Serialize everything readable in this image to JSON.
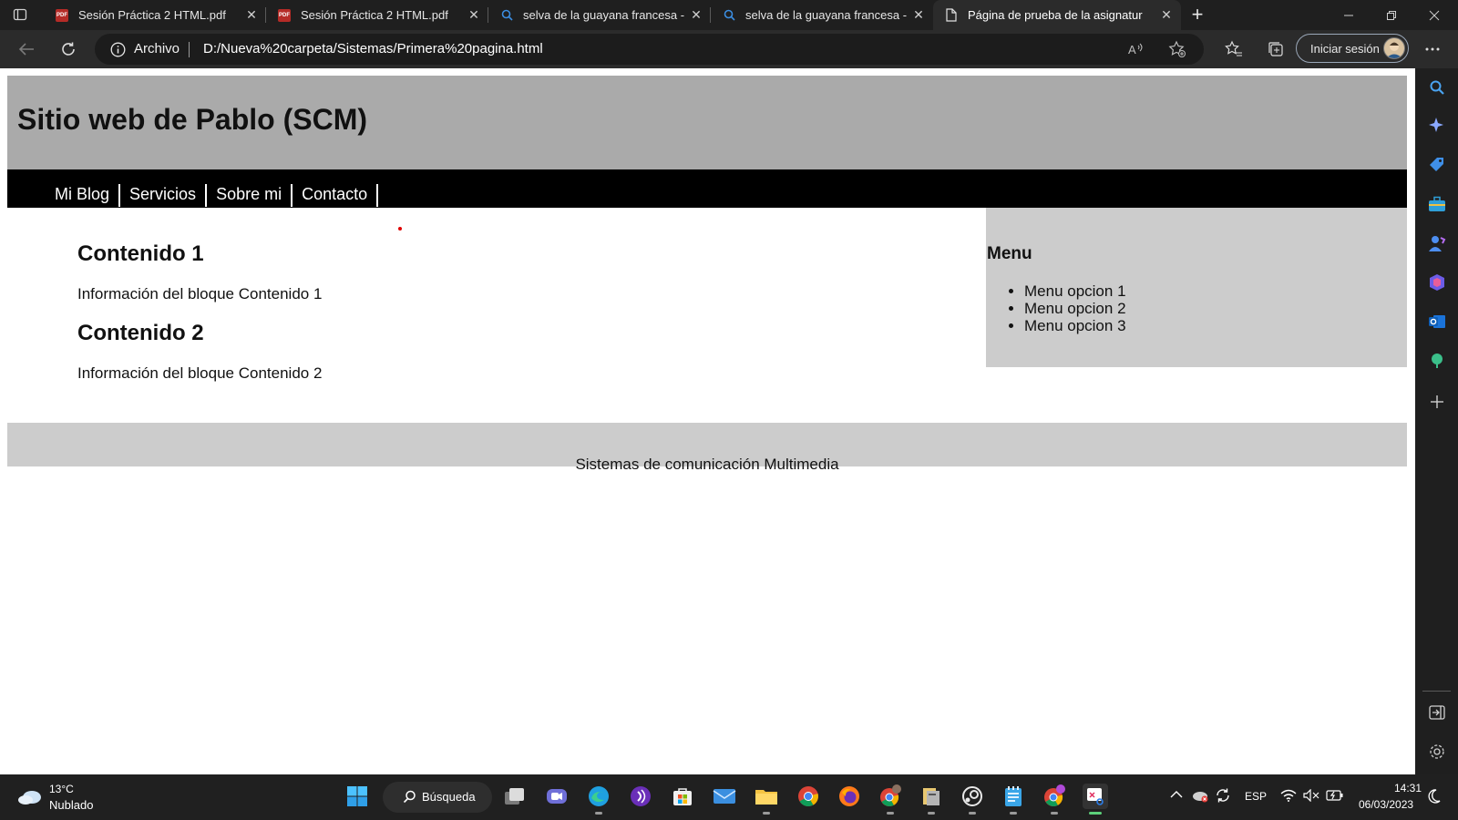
{
  "browser": {
    "tabs": [
      {
        "title": "Sesión Práctica 2 HTML.pdf",
        "icon": "pdf-icon"
      },
      {
        "title": "Sesión Práctica 2 HTML.pdf",
        "icon": "pdf-icon"
      },
      {
        "title": "selva de la guayana francesa - Bi",
        "icon": "search-icon"
      },
      {
        "title": "selva de la guayana francesa - Bi",
        "icon": "search-icon"
      },
      {
        "title": "Página de prueba de la asignatur",
        "icon": "page-icon"
      }
    ],
    "address": {
      "label": "Archivo",
      "url": "D:/Nueva%20carpeta/Sistemas/Primera%20pagina.html"
    },
    "signin_label": "Iniciar sesión"
  },
  "page": {
    "header_title": "Sitio web de Pablo (SCM)",
    "nav": [
      "Mi Blog",
      "Servicios",
      "Sobre mi",
      "Contacto"
    ],
    "sections": [
      {
        "heading": "Contenido 1",
        "text": "Información del bloque Contenido 1"
      },
      {
        "heading": "Contenido 2",
        "text": "Información del bloque Contenido 2"
      }
    ],
    "aside": {
      "heading": "Menu",
      "items": [
        "Menu opcion 1",
        "Menu opcion 2",
        "Menu opcion 3"
      ]
    },
    "footer": "Sistemas de comunicación Multimedia"
  },
  "taskbar": {
    "weather": {
      "temp": "13°C",
      "condition": "Nublado"
    },
    "search_label": "Búsqueda",
    "language": "ESP",
    "time": "14:31",
    "date": "06/03/2023"
  },
  "colors": {
    "header_bg": "#aaaaaa",
    "nav_bg": "#000000",
    "aside_bg": "#cccccc",
    "footer_bg": "#cccccc",
    "chrome_bg": "#1f1f1f"
  }
}
